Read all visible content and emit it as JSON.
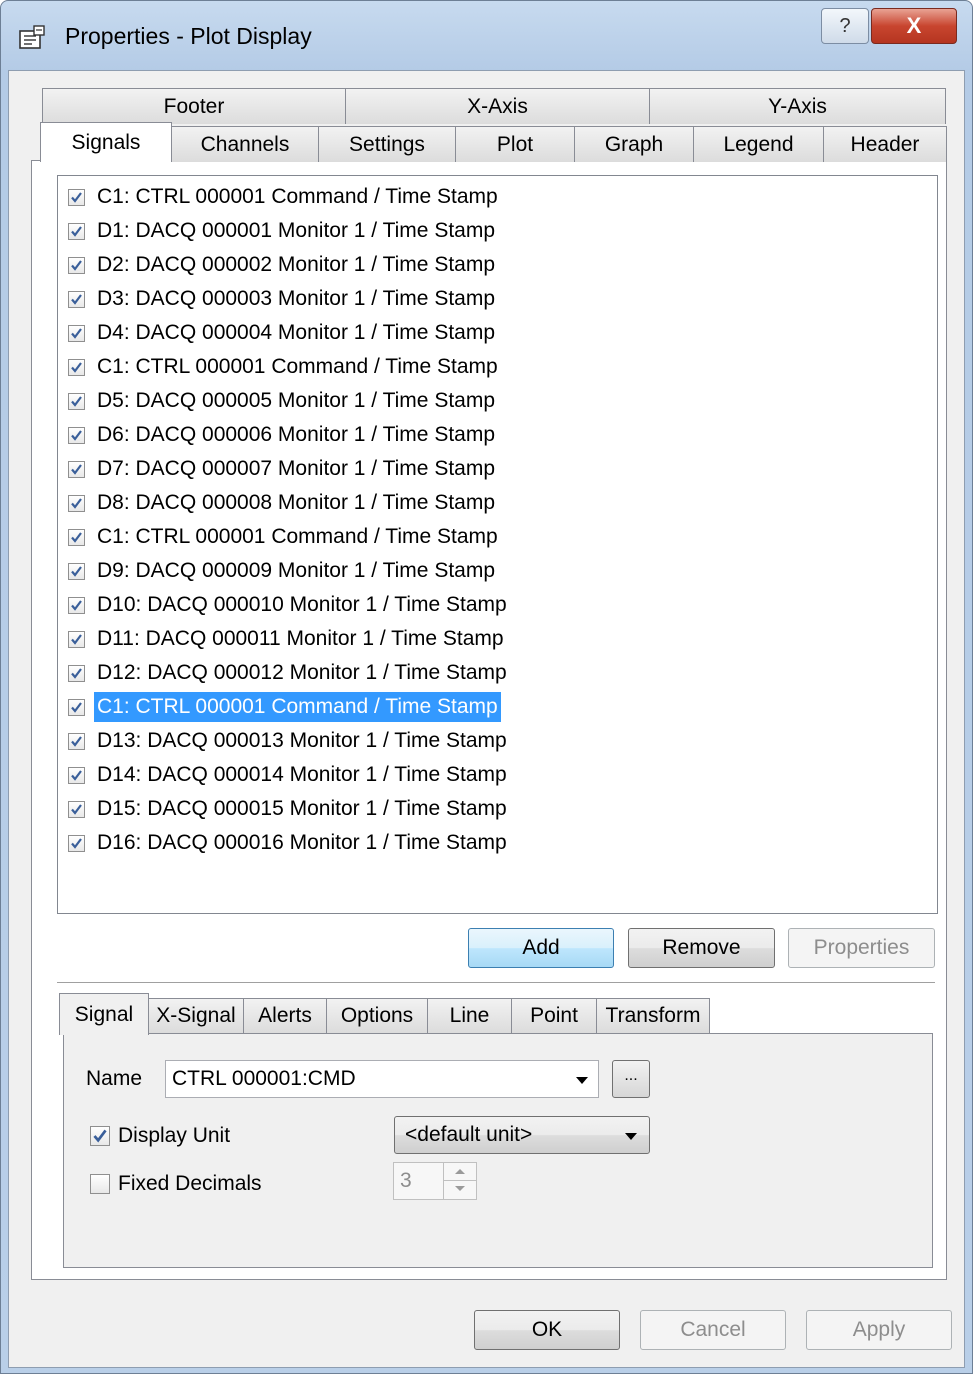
{
  "window": {
    "title": "Properties - Plot Display",
    "help_label": "?",
    "close_label": "X"
  },
  "top_tabs_row1": [
    "Footer",
    "X-Axis",
    "Y-Axis"
  ],
  "top_tabs_row2": [
    "Signals",
    "Channels",
    "Settings",
    "Plot",
    "Graph",
    "Legend",
    "Header"
  ],
  "signals": [
    {
      "label": "C1:  CTRL 000001 Command / Time Stamp",
      "checked": true
    },
    {
      "label": "D1:  DACQ 000001 Monitor 1 / Time Stamp",
      "checked": true
    },
    {
      "label": "D2:  DACQ 000002 Monitor 1 / Time Stamp",
      "checked": true
    },
    {
      "label": "D3:  DACQ 000003 Monitor 1 / Time Stamp",
      "checked": true
    },
    {
      "label": "D4:  DACQ 000004 Monitor 1 / Time Stamp",
      "checked": true
    },
    {
      "label": "C1:  CTRL 000001 Command / Time Stamp",
      "checked": true
    },
    {
      "label": "D5:  DACQ 000005 Monitor 1 / Time Stamp",
      "checked": true
    },
    {
      "label": "D6:  DACQ 000006 Monitor 1 / Time Stamp",
      "checked": true
    },
    {
      "label": "D7:  DACQ 000007 Monitor 1 / Time Stamp",
      "checked": true
    },
    {
      "label": "D8:  DACQ 000008 Monitor 1 / Time Stamp",
      "checked": true
    },
    {
      "label": "C1:  CTRL 000001 Command / Time Stamp",
      "checked": true
    },
    {
      "label": "D9:  DACQ 000009 Monitor 1 / Time Stamp",
      "checked": true
    },
    {
      "label": "D10:  DACQ 000010 Monitor 1 / Time Stamp",
      "checked": true
    },
    {
      "label": "D11:  DACQ 000011 Monitor 1 / Time Stamp",
      "checked": true
    },
    {
      "label": "D12:  DACQ 000012 Monitor 1 / Time Stamp",
      "checked": true
    },
    {
      "label": "C1:  CTRL 000001 Command / Time Stamp",
      "checked": true,
      "selected": true
    },
    {
      "label": "D13:  DACQ 000013 Monitor 1 / Time Stamp",
      "checked": true
    },
    {
      "label": "D14:  DACQ 000014 Monitor 1 / Time Stamp",
      "checked": true
    },
    {
      "label": "D15:  DACQ 000015 Monitor 1 / Time Stamp",
      "checked": true
    },
    {
      "label": "D16:  DACQ 000016 Monitor 1 / Time Stamp",
      "checked": true
    }
  ],
  "list_buttons": {
    "add": "Add",
    "remove": "Remove",
    "properties": "Properties"
  },
  "sub_tabs": [
    "Signal",
    "X-Signal",
    "Alerts",
    "Options",
    "Line",
    "Point",
    "Transform"
  ],
  "signal_panel": {
    "name_label": "Name",
    "name_value": "CTRL 000001:CMD",
    "browse_label": "...",
    "display_unit_label": "Display Unit",
    "display_unit_checked": true,
    "unit_value": "<default unit>",
    "fixed_decimals_label": "Fixed Decimals",
    "fixed_decimals_checked": false,
    "decimals_value": "3"
  },
  "footer_buttons": {
    "ok": "OK",
    "cancel": "Cancel",
    "apply": "Apply"
  },
  "colors": {
    "selection": "#3399ff",
    "title_bar": "#b9cfe8",
    "close_button": "#c8452f"
  }
}
